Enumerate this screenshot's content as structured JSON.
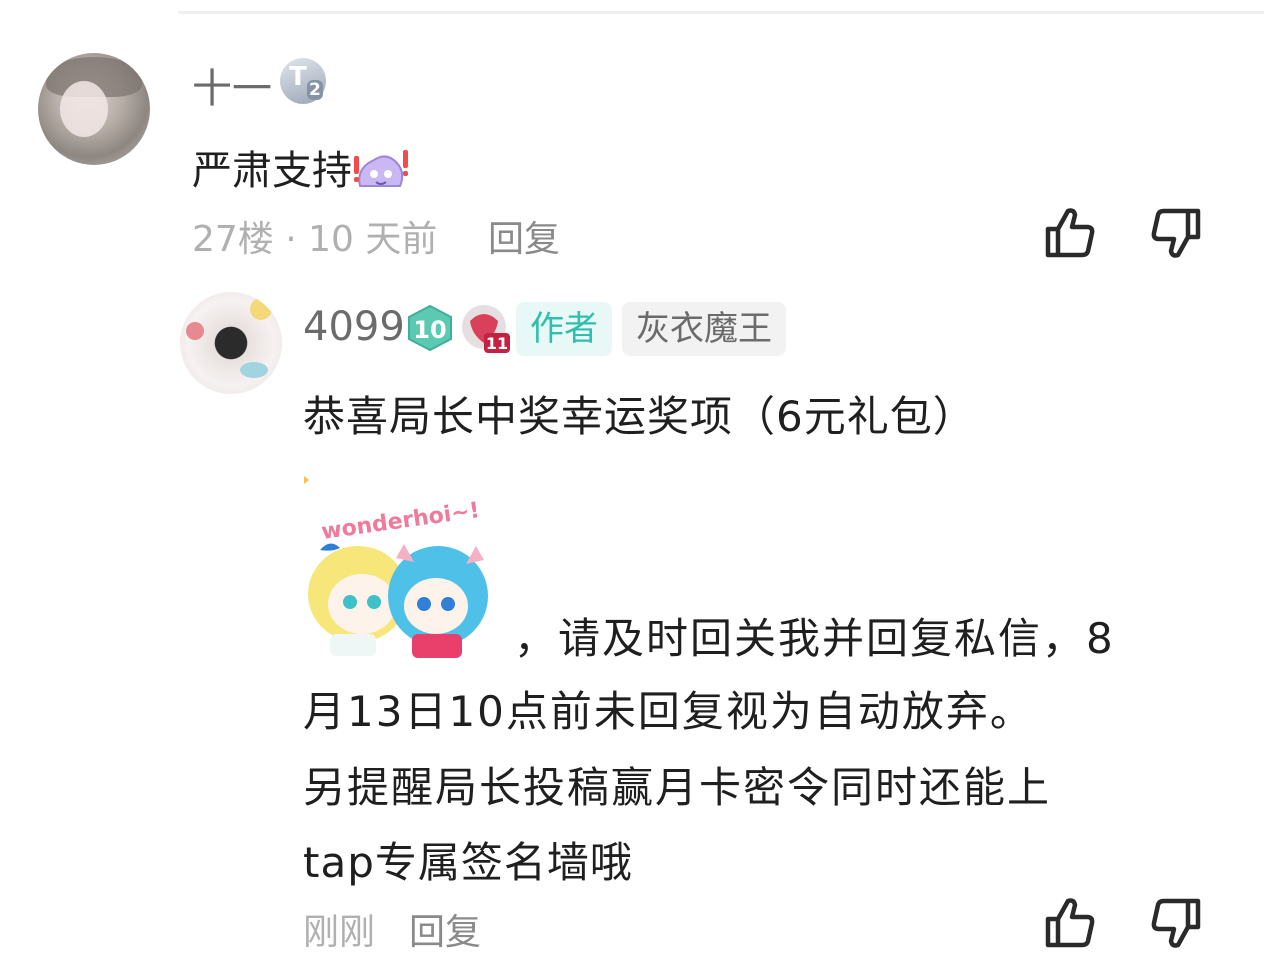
{
  "comment1": {
    "username": "十一",
    "badge": {
      "letter": "T",
      "number": "2"
    },
    "text": "严肃支持",
    "emoji": "excited-blob-emoji",
    "meta": "27楼 · 10 天前",
    "reply_label": "回复"
  },
  "comment2": {
    "username": "4099",
    "level_badge": "10",
    "rank_badge": "11",
    "author_tag": "作者",
    "title_tag": "灰衣魔王",
    "line1": "恭喜局长中奖幸运奖项（6元礼包）",
    "sticker_text": "wonderhoi~!",
    "line2": "，请及时回关我并回复私信，8",
    "line3": "月13日10点前未回复视为自动放弃。",
    "line4": "另提醒局长投稿赢月卡密令同时还能上",
    "line5": "tap专属签名墙哦",
    "time": "刚刚",
    "reply_label": "回复"
  },
  "icons": [
    "thumbs-up-icon",
    "thumbs-down-icon"
  ],
  "colors": {
    "accent": "#2fc0ad",
    "muted": "#b0b0b0",
    "text": "#1f1f1f"
  }
}
